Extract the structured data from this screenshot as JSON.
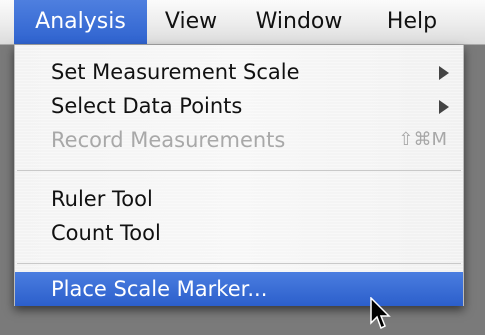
{
  "menubar": {
    "items": [
      {
        "label": "Analysis"
      },
      {
        "label": "View"
      },
      {
        "label": "Window"
      },
      {
        "label": "Help"
      }
    ]
  },
  "dropdown": {
    "items": [
      {
        "label": "Set Measurement Scale",
        "submenu": true
      },
      {
        "label": "Select Data Points",
        "submenu": true
      },
      {
        "label": "Record Measurements",
        "shortcut": "⇧⌘M",
        "enabled": false
      },
      {
        "label": "Ruler Tool"
      },
      {
        "label": "Count Tool"
      },
      {
        "label": "Place Scale Marker...",
        "highlighted": true
      }
    ]
  },
  "colors": {
    "highlight": "#2f63cf",
    "disabled_text": "#a8a8a8"
  }
}
